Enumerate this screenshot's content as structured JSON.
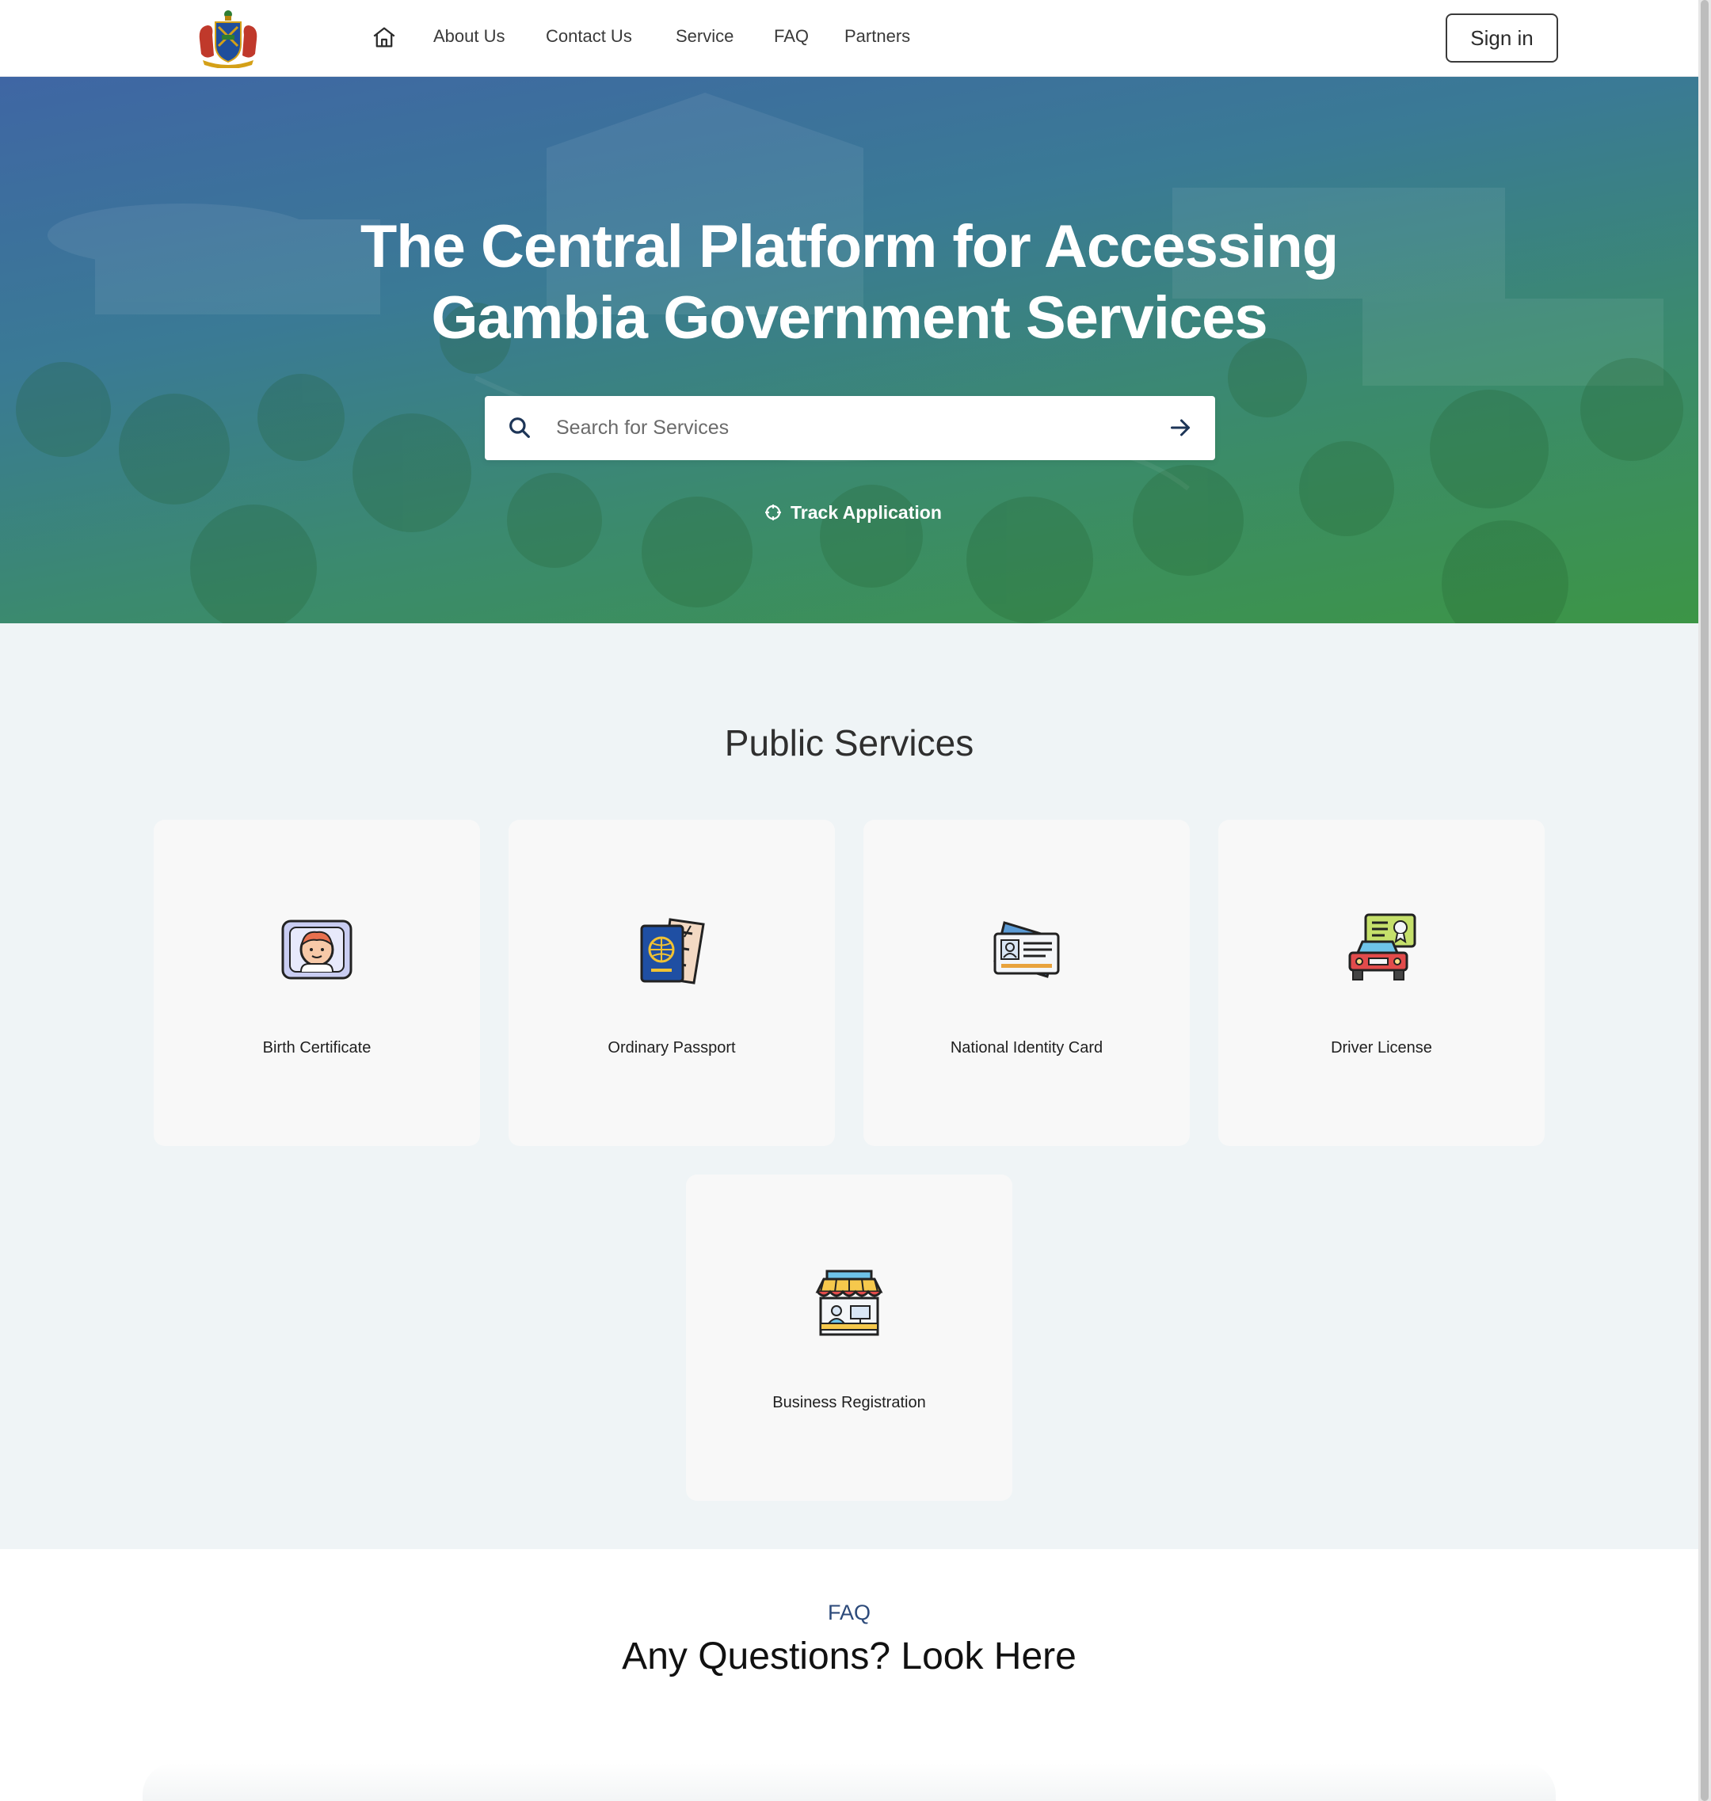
{
  "nav": {
    "logo_icon": "gambia-coat-of-arms-icon",
    "home_icon": "home-icon",
    "links": [
      "About Us",
      "Contact Us",
      "Service",
      "FAQ",
      "Partners"
    ],
    "signin_label": "Sign in"
  },
  "hero": {
    "title_line1": "The Central Platform for Accessing",
    "title_line2": "Gambia Government Services",
    "search_placeholder": "Search for Services",
    "search_icon": "search-icon",
    "submit_icon": "arrow-right-icon",
    "track_label": "Track Application",
    "track_icon": "crosshair-icon",
    "gradient_colors": [
      "#3f66a4",
      "#3c9546"
    ]
  },
  "services": {
    "title": "Public Services",
    "cards": [
      {
        "label": "Birth Certificate",
        "icon": "baby-portrait-icon"
      },
      {
        "label": "Ordinary Passport",
        "icon": "passport-icon"
      },
      {
        "label": "National Identity Card",
        "icon": "id-card-icon"
      },
      {
        "label": "Driver License",
        "icon": "car-license-icon"
      },
      {
        "label": "Business Registration",
        "icon": "storefront-icon"
      }
    ]
  },
  "faq": {
    "kicker": "FAQ",
    "title": "Any Questions? Look Here"
  },
  "colors": {
    "accent_navy": "#2c4a7a",
    "page_bg": "#eff4f6",
    "card_bg": "#f8f8f8"
  }
}
